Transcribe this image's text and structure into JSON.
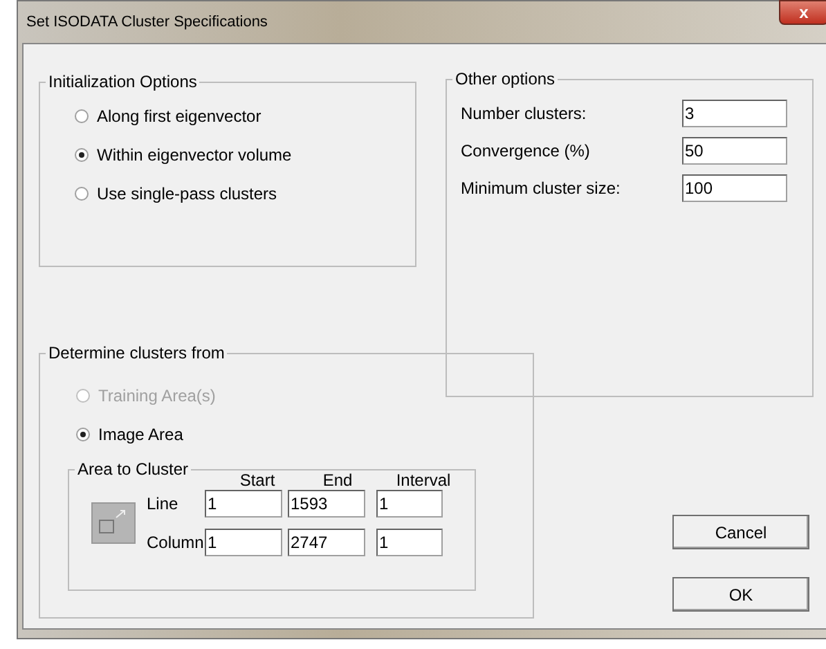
{
  "window": {
    "title": "Set ISODATA Cluster Specifications",
    "close": "x"
  },
  "initialization": {
    "title": "Initialization Options",
    "options": [
      {
        "label": "Along first eigenvector",
        "selected": false
      },
      {
        "label": "Within eigenvector volume",
        "selected": true
      },
      {
        "label": "Use single-pass clusters",
        "selected": false
      }
    ]
  },
  "other_options": {
    "title": "Other options",
    "fields": [
      {
        "label": "Number clusters:",
        "value": "3"
      },
      {
        "label": "Convergence (%)",
        "value": "50"
      },
      {
        "label": "Minimum cluster size:",
        "value": "100"
      }
    ]
  },
  "determine": {
    "title": "Determine clusters from",
    "options": [
      {
        "label": "Training Area(s)",
        "selected": false,
        "disabled": true
      },
      {
        "label": "Image Area",
        "selected": true,
        "disabled": false
      }
    ],
    "area": {
      "title": "Area to Cluster",
      "columns": [
        "Start",
        "End",
        "Interval"
      ],
      "rows": [
        {
          "label": "Line",
          "values": [
            "1",
            "1593",
            "1"
          ]
        },
        {
          "label": "Column",
          "values": [
            "1",
            "2747",
            "1"
          ]
        }
      ]
    }
  },
  "buttons": [
    "Cancel",
    "OK"
  ]
}
